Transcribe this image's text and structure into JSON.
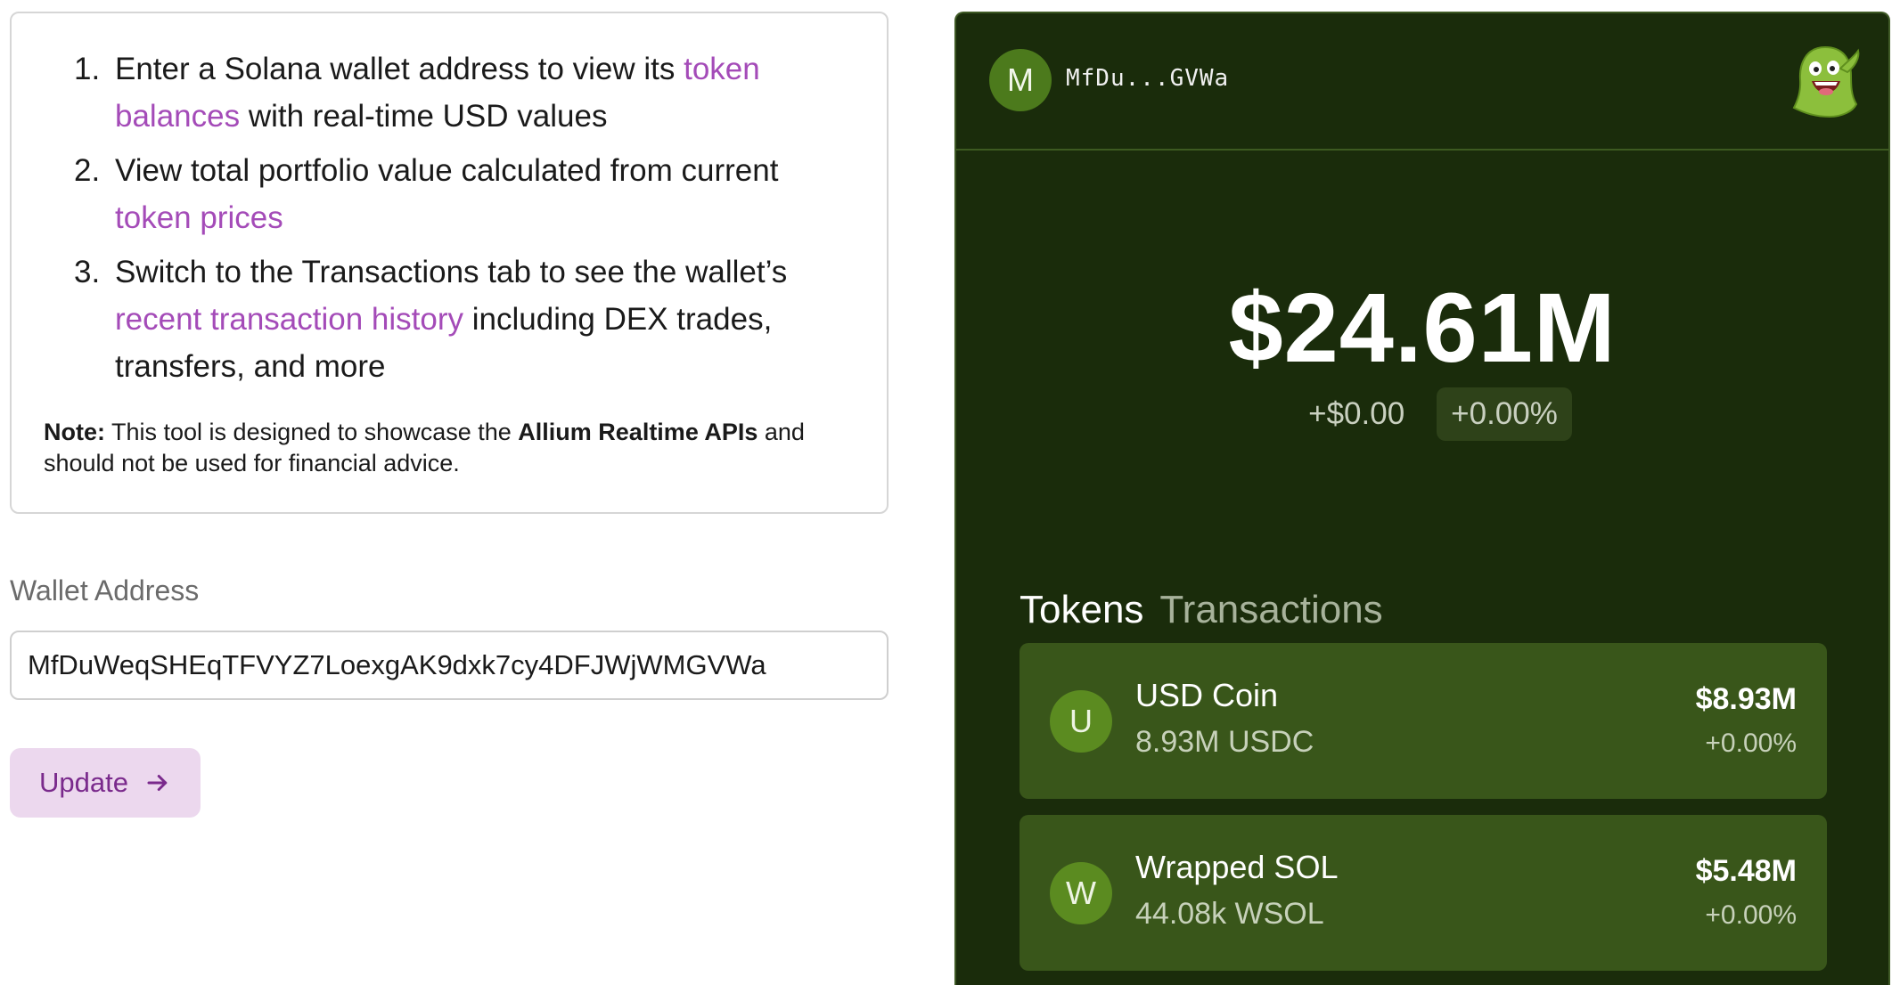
{
  "instructions": {
    "steps": [
      {
        "number": "1.",
        "before": "Enter a Solana wallet address to view its ",
        "highlight": "token balances",
        "after": " with real-time USD values"
      },
      {
        "number": "2.",
        "before": "View total portfolio value calculated from current ",
        "highlight": "token prices",
        "after": ""
      },
      {
        "number": "3.",
        "before": "Switch to the Transactions tab to see the wallet’s ",
        "highlight": "recent transaction history",
        "after": " including DEX trades, transfers, and more"
      }
    ],
    "note": {
      "label": "Note:",
      "text_before": " This tool is designed to showcase the ",
      "bold": "Allium Realtime APIs",
      "text_after": " and should not be used for financial advice."
    }
  },
  "wallet_form": {
    "label": "Wallet Address",
    "value": "MfDuWeqSHEqTFVYZ7LoexgAK9dxk7cy4DFJWjWMGVWa",
    "button_label": "Update",
    "button_icon": "arrow-right-icon"
  },
  "wallet_panel": {
    "avatar_letter": "M",
    "short_address": "MfDu...GVWa",
    "mascot_icon": "green-ghost-mascot",
    "total_value": "$24.61M",
    "change_abs": "+$0.00",
    "change_pct": "+0.00%",
    "tabs": [
      {
        "label": "Tokens",
        "active": true
      },
      {
        "label": "Transactions",
        "active": false
      }
    ],
    "tokens": [
      {
        "icon_letter": "U",
        "name": "USD Coin",
        "amount": "8.93M USDC",
        "value": "$8.93M",
        "change": "+0.00%"
      },
      {
        "icon_letter": "W",
        "name": "Wrapped SOL",
        "amount": "44.08k WSOL",
        "value": "$5.48M",
        "change": "+0.00%"
      }
    ]
  },
  "colors": {
    "accent_purple": "#a44bb8",
    "button_bg": "#ecd8ee",
    "panel_bg": "#1a2c0b",
    "card_bg": "#39561a",
    "avatar_green": "#4c7a1c"
  }
}
